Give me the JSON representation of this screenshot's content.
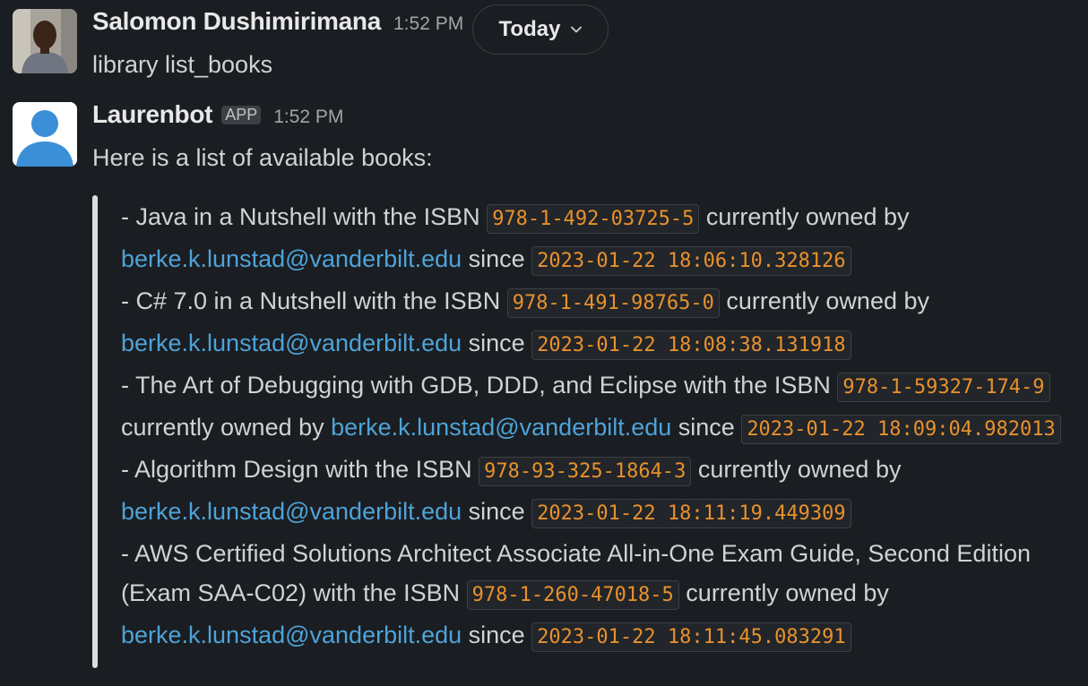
{
  "date_divider": {
    "label": "Today",
    "chevron_icon": "chevron-down-icon"
  },
  "messages": [
    {
      "sender": "Salomon Dushimirimana",
      "time": "1:52 PM",
      "text": "library list_books"
    },
    {
      "sender": "Laurenbot",
      "badge": "APP",
      "time": "1:52 PM",
      "text": "Here is a list of available books:"
    }
  ],
  "books": [
    {
      "prefix": "- Java in a Nutshell with the ISBN ",
      "isbn": "978-1-492-03725-5",
      "owned_by": " currently owned by ",
      "email": "berke.k.lunstad@vanderbilt.edu",
      "since": " since ",
      "date": "2023-01-22 18:06:10.328126"
    },
    {
      "prefix": "- C# 7.0 in a Nutshell with the ISBN ",
      "isbn": "978-1-491-98765-0",
      "owned_by": " currently owned by ",
      "email": "berke.k.lunstad@vanderbilt.edu",
      "since": " since ",
      "date": "2023-01-22 18:08:38.131918"
    },
    {
      "prefix": "- The Art of Debugging with GDB, DDD, and Eclipse with the ISBN ",
      "isbn": "978-1-59327-174-9",
      "owned_by": " currently owned by ",
      "email": "berke.k.lunstad@vanderbilt.edu",
      "since": " since ",
      "date": "2023-01-22 18:09:04.982013"
    },
    {
      "prefix": "- Algorithm Design with the ISBN ",
      "isbn": "978-93-325-1864-3",
      "owned_by": " currently owned by ",
      "email": "berke.k.lunstad@vanderbilt.edu",
      "since": " since ",
      "date": "2023-01-22 18:11:19.449309"
    },
    {
      "prefix": "- AWS Certified Solutions Architect Associate All-in-One Exam Guide, Second Edition (Exam SAA-C02) with the ISBN ",
      "isbn": "978-1-260-47018-5",
      "owned_by": " currently owned by ",
      "email": "berke.k.lunstad@vanderbilt.edu",
      "since": " since ",
      "date": "2023-01-22 18:11:45.083291"
    }
  ],
  "colors": {
    "background": "#1a1d21",
    "text": "#d1d2d3",
    "code_text": "#e8912d",
    "link": "#4ea3d8",
    "quote_bar": "#dddddd"
  }
}
